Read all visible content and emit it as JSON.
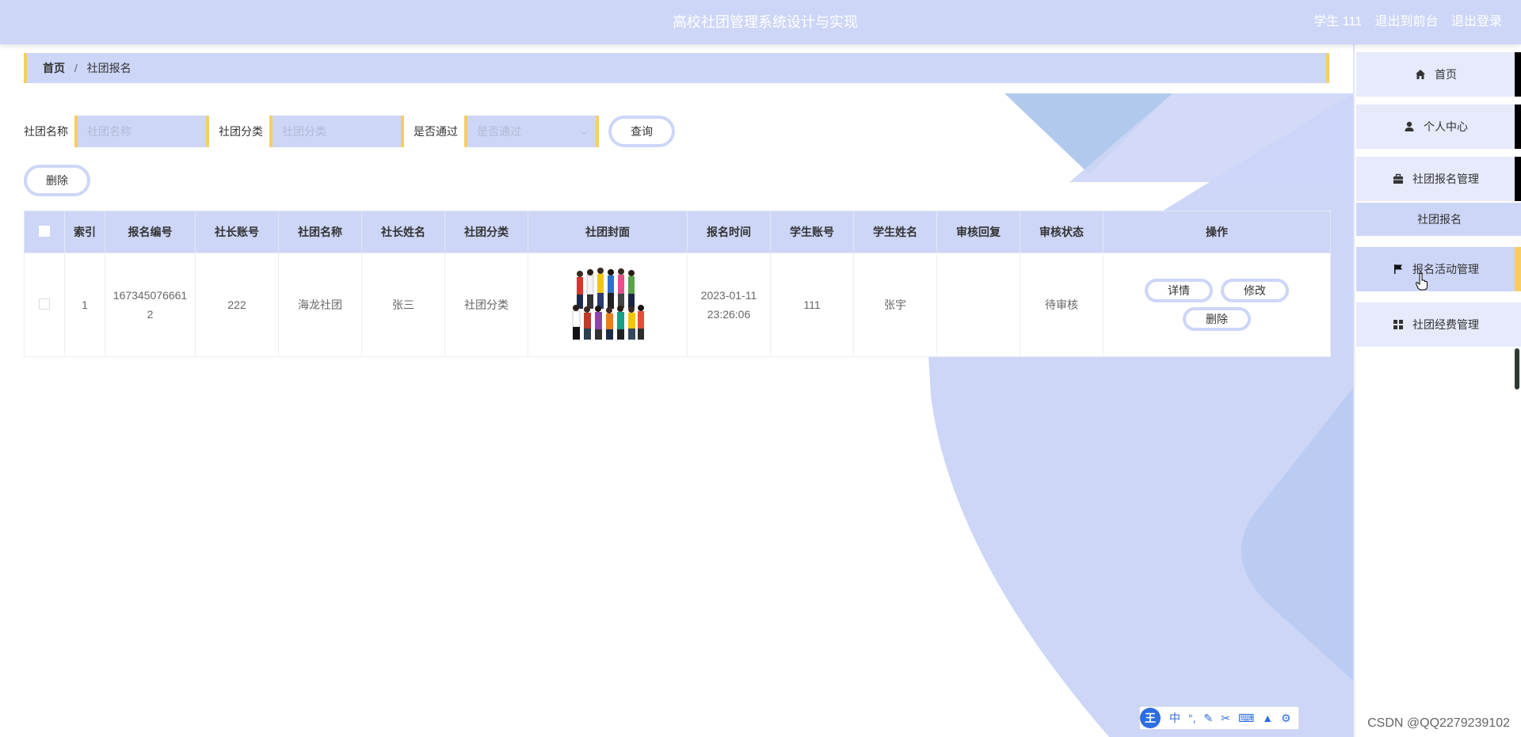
{
  "header": {
    "title": "高校社团管理系统设计与实现",
    "user": "学生 111",
    "back_to_front": "退出到前台",
    "logout": "退出登录"
  },
  "breadcrumb": {
    "home": "首页",
    "separator": "/",
    "current": "社团报名"
  },
  "search": {
    "club_name_label": "社团名称",
    "club_name_placeholder": "社团名称",
    "club_category_label": "社团分类",
    "club_category_placeholder": "社团分类",
    "approved_label": "是否通过",
    "approved_placeholder": "是否通过",
    "query_label": "查询"
  },
  "toolbar": {
    "delete_label": "删除"
  },
  "table": {
    "columns": [
      "索引",
      "报名编号",
      "社长账号",
      "社团名称",
      "社长姓名",
      "社团分类",
      "社团封面",
      "报名时间",
      "学生账号",
      "学生姓名",
      "审核回复",
      "审核状态",
      "操作"
    ],
    "rows": [
      {
        "index": "1",
        "reg_no": "1673450766612",
        "leader_account": "222",
        "club_name": "海龙社团",
        "leader_name": "张三",
        "club_category": "社团分类",
        "reg_time": "2023-01-11 23:26:06",
        "student_account": "111",
        "student_name": "张宇",
        "review_reply": "",
        "review_status": "待审核",
        "actions": {
          "detail": "详情",
          "edit": "修改",
          "delete": "删除"
        }
      }
    ]
  },
  "sidebar": {
    "items": [
      {
        "label": "首页",
        "icon": "home-icon"
      },
      {
        "label": "个人中心",
        "icon": "user-icon"
      },
      {
        "label": "社团报名管理",
        "icon": "briefcase-icon"
      },
      {
        "label": "报名活动管理",
        "icon": "flag-icon"
      },
      {
        "label": "社团经费管理",
        "icon": "grid-icon"
      }
    ],
    "submenu": "社团报名"
  },
  "ime": {
    "logo": "王",
    "lang": "中"
  },
  "watermark": "CSDN @QQ2279239102",
  "colors": {
    "accent": "#cdd6f7",
    "highlight": "#f7cd63"
  }
}
